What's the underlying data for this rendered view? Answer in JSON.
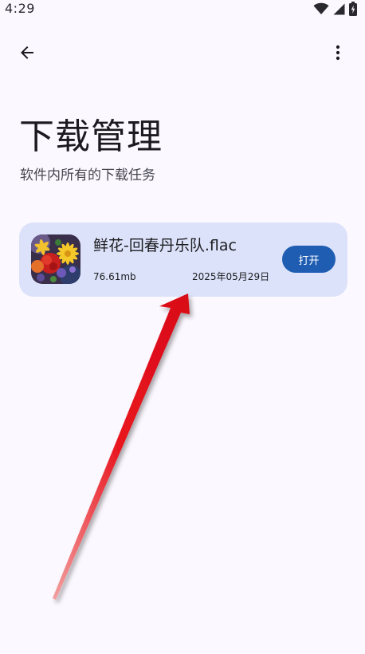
{
  "status_bar": {
    "time": "4:29"
  },
  "app_bar": {
    "back_icon": "arrow-left-icon",
    "more_icon": "more-vertical-icon"
  },
  "header": {
    "title": "下载管理",
    "subtitle": "软件内所有的下载任务"
  },
  "downloads": [
    {
      "file_name": "鲜花-回春丹乐队.flac",
      "size": "76.61mb",
      "date": "2025年05月29日",
      "action_label": "打开",
      "cover_icon": "flower-album-cover"
    }
  ],
  "colors": {
    "background": "#FCF8FF",
    "card": "#DCE2F9",
    "primary_button": "#1F5DB3",
    "annotation_arrow": "#E8141E"
  }
}
